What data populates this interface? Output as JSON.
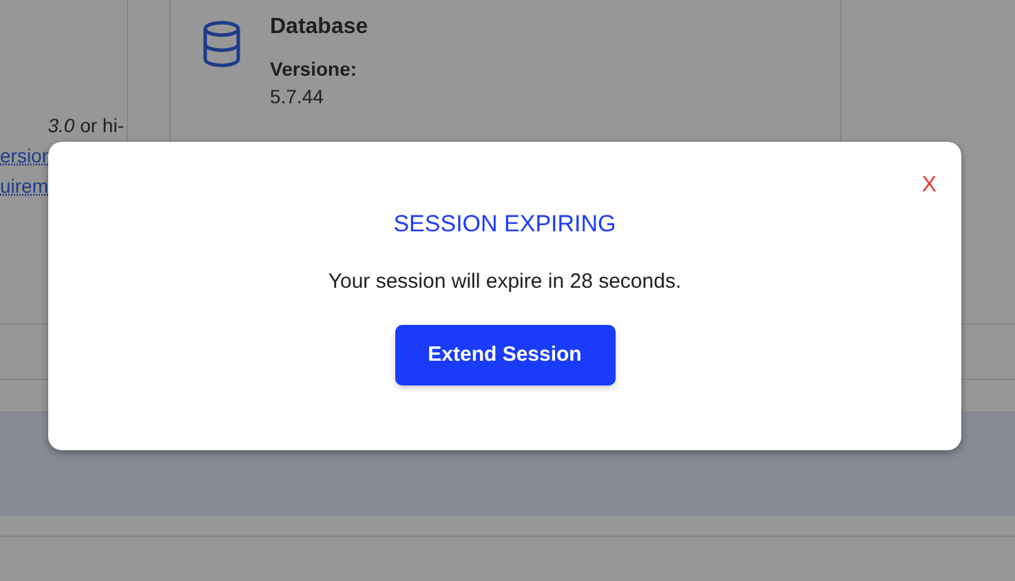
{
  "left_column": {
    "text": "*3.0* or hi-",
    "links": [
      "ersion",
      "uirem"
    ]
  },
  "database_card": {
    "title": "Database",
    "fields": [
      {
        "label": "Versione:",
        "value": "5.7.44"
      }
    ]
  },
  "dialog": {
    "title": "SESSION EXPIRING",
    "message": "Your session will expire in 28 seconds.",
    "close": "X",
    "button": "Extend Session"
  }
}
